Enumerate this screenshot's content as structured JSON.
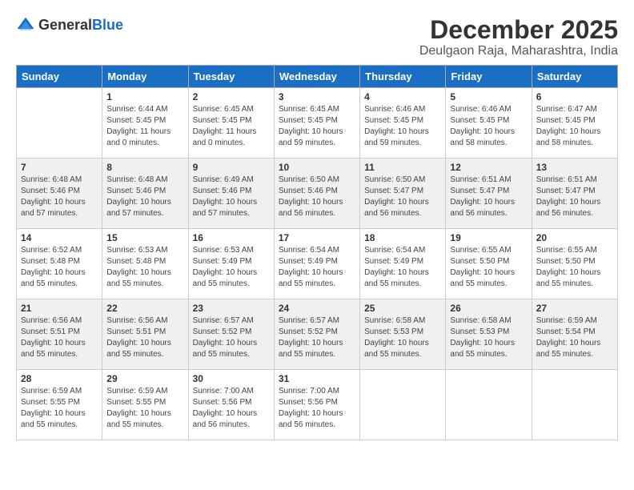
{
  "header": {
    "logo_general": "General",
    "logo_blue": "Blue",
    "month_title": "December 2025",
    "location": "Deulgaon Raja, Maharashtra, India"
  },
  "weekdays": [
    "Sunday",
    "Monday",
    "Tuesday",
    "Wednesday",
    "Thursday",
    "Friday",
    "Saturday"
  ],
  "weeks": [
    [
      {
        "day": "",
        "info": ""
      },
      {
        "day": "1",
        "info": "Sunrise: 6:44 AM\nSunset: 5:45 PM\nDaylight: 11 hours\nand 0 minutes."
      },
      {
        "day": "2",
        "info": "Sunrise: 6:45 AM\nSunset: 5:45 PM\nDaylight: 11 hours\nand 0 minutes."
      },
      {
        "day": "3",
        "info": "Sunrise: 6:45 AM\nSunset: 5:45 PM\nDaylight: 10 hours\nand 59 minutes."
      },
      {
        "day": "4",
        "info": "Sunrise: 6:46 AM\nSunset: 5:45 PM\nDaylight: 10 hours\nand 59 minutes."
      },
      {
        "day": "5",
        "info": "Sunrise: 6:46 AM\nSunset: 5:45 PM\nDaylight: 10 hours\nand 58 minutes."
      },
      {
        "day": "6",
        "info": "Sunrise: 6:47 AM\nSunset: 5:45 PM\nDaylight: 10 hours\nand 58 minutes."
      }
    ],
    [
      {
        "day": "7",
        "info": "Sunrise: 6:48 AM\nSunset: 5:46 PM\nDaylight: 10 hours\nand 57 minutes."
      },
      {
        "day": "8",
        "info": "Sunrise: 6:48 AM\nSunset: 5:46 PM\nDaylight: 10 hours\nand 57 minutes."
      },
      {
        "day": "9",
        "info": "Sunrise: 6:49 AM\nSunset: 5:46 PM\nDaylight: 10 hours\nand 57 minutes."
      },
      {
        "day": "10",
        "info": "Sunrise: 6:50 AM\nSunset: 5:46 PM\nDaylight: 10 hours\nand 56 minutes."
      },
      {
        "day": "11",
        "info": "Sunrise: 6:50 AM\nSunset: 5:47 PM\nDaylight: 10 hours\nand 56 minutes."
      },
      {
        "day": "12",
        "info": "Sunrise: 6:51 AM\nSunset: 5:47 PM\nDaylight: 10 hours\nand 56 minutes."
      },
      {
        "day": "13",
        "info": "Sunrise: 6:51 AM\nSunset: 5:47 PM\nDaylight: 10 hours\nand 56 minutes."
      }
    ],
    [
      {
        "day": "14",
        "info": "Sunrise: 6:52 AM\nSunset: 5:48 PM\nDaylight: 10 hours\nand 55 minutes."
      },
      {
        "day": "15",
        "info": "Sunrise: 6:53 AM\nSunset: 5:48 PM\nDaylight: 10 hours\nand 55 minutes."
      },
      {
        "day": "16",
        "info": "Sunrise: 6:53 AM\nSunset: 5:49 PM\nDaylight: 10 hours\nand 55 minutes."
      },
      {
        "day": "17",
        "info": "Sunrise: 6:54 AM\nSunset: 5:49 PM\nDaylight: 10 hours\nand 55 minutes."
      },
      {
        "day": "18",
        "info": "Sunrise: 6:54 AM\nSunset: 5:49 PM\nDaylight: 10 hours\nand 55 minutes."
      },
      {
        "day": "19",
        "info": "Sunrise: 6:55 AM\nSunset: 5:50 PM\nDaylight: 10 hours\nand 55 minutes."
      },
      {
        "day": "20",
        "info": "Sunrise: 6:55 AM\nSunset: 5:50 PM\nDaylight: 10 hours\nand 55 minutes."
      }
    ],
    [
      {
        "day": "21",
        "info": "Sunrise: 6:56 AM\nSunset: 5:51 PM\nDaylight: 10 hours\nand 55 minutes."
      },
      {
        "day": "22",
        "info": "Sunrise: 6:56 AM\nSunset: 5:51 PM\nDaylight: 10 hours\nand 55 minutes."
      },
      {
        "day": "23",
        "info": "Sunrise: 6:57 AM\nSunset: 5:52 PM\nDaylight: 10 hours\nand 55 minutes."
      },
      {
        "day": "24",
        "info": "Sunrise: 6:57 AM\nSunset: 5:52 PM\nDaylight: 10 hours\nand 55 minutes."
      },
      {
        "day": "25",
        "info": "Sunrise: 6:58 AM\nSunset: 5:53 PM\nDaylight: 10 hours\nand 55 minutes."
      },
      {
        "day": "26",
        "info": "Sunrise: 6:58 AM\nSunset: 5:53 PM\nDaylight: 10 hours\nand 55 minutes."
      },
      {
        "day": "27",
        "info": "Sunrise: 6:59 AM\nSunset: 5:54 PM\nDaylight: 10 hours\nand 55 minutes."
      }
    ],
    [
      {
        "day": "28",
        "info": "Sunrise: 6:59 AM\nSunset: 5:55 PM\nDaylight: 10 hours\nand 55 minutes."
      },
      {
        "day": "29",
        "info": "Sunrise: 6:59 AM\nSunset: 5:55 PM\nDaylight: 10 hours\nand 55 minutes."
      },
      {
        "day": "30",
        "info": "Sunrise: 7:00 AM\nSunset: 5:56 PM\nDaylight: 10 hours\nand 56 minutes."
      },
      {
        "day": "31",
        "info": "Sunrise: 7:00 AM\nSunset: 5:56 PM\nDaylight: 10 hours\nand 56 minutes."
      },
      {
        "day": "",
        "info": ""
      },
      {
        "day": "",
        "info": ""
      },
      {
        "day": "",
        "info": ""
      }
    ]
  ]
}
